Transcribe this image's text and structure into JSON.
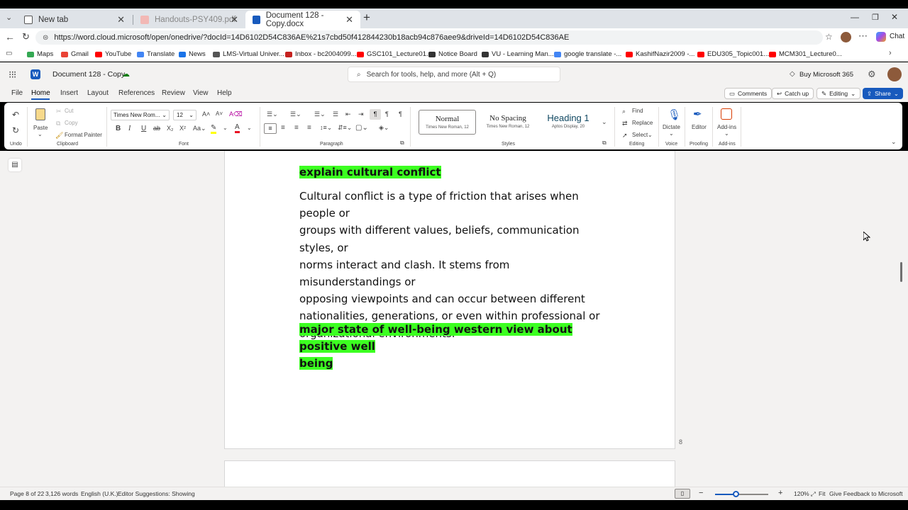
{
  "browser": {
    "tabs": [
      {
        "label": "New tab"
      },
      {
        "label": "Handouts-PSY409.pdf"
      },
      {
        "label": "Document 128 - Copy.docx"
      }
    ],
    "url": "https://word.cloud.microsoft/open/onedrive/?docId=14D6102D54C836AE%21s7cbd50f412844230b18acb94c876aee9&driveId=14D6102D54C836AE",
    "bookmarks": [
      "Maps",
      "Gmail",
      "YouTube",
      "Translate",
      "News",
      "LMS-Virtual Univer...",
      "Inbox - bc2004099...",
      "GSC101_Lecture01...",
      "Notice Board",
      "VU - Learning Man...",
      "google translate -...",
      "KashifNazir2009 -...",
      "EDU305_Topic001...",
      "MCM301_Lecture0..."
    ],
    "chat_label": "Chat"
  },
  "word": {
    "doc_title": "Document 128 - Copy",
    "search_placeholder": "Search for tools, help, and more (Alt + Q)",
    "buy_label": "Buy Microsoft 365",
    "menus": [
      "File",
      "Home",
      "Insert",
      "Layout",
      "References",
      "Review",
      "View",
      "Help"
    ],
    "comments_label": "Comments",
    "catchup_label": "Catch up",
    "editing_label": "Editing",
    "share_label": "Share"
  },
  "ribbon": {
    "undo_label": "Undo",
    "paste_label": "Paste",
    "cut_label": "Cut",
    "copy_label": "Copy",
    "format_painter_label": "Format Painter",
    "clipboard_label": "Clipboard",
    "font_name": "Times New Rom...",
    "font_size": "12",
    "font_label": "Font",
    "paragraph_label": "Paragraph",
    "styles": [
      {
        "name": "Normal",
        "sub": "Times New Roman, 12"
      },
      {
        "name": "No Spacing",
        "sub": "Times New Roman, 12"
      },
      {
        "name": "Heading 1",
        "sub": "Aptos Display, 20"
      }
    ],
    "styles_label": "Styles",
    "find_label": "Find",
    "replace_label": "Replace",
    "select_label": "Select",
    "editing_group_label": "Editing",
    "dictate_label": "Dictate",
    "voice_label": "Voice",
    "editor_label": "Editor",
    "proofing_label": "Proofing",
    "addins_label": "Add-ins",
    "addins_group_label": "Add-ins"
  },
  "document": {
    "heading1": "explain cultural conflict",
    "para_lines": [
      "Cultural conflict is a type of friction that arises when people or",
      "groups with different values, beliefs, communication styles, or",
      "norms interact and clash. It stems from misunderstandings or",
      "opposing viewpoints and can occur between different",
      "nationalities, generations, or even within professional or",
      "organizational environments."
    ],
    "heading2_line1": "major state of well-being western view about positive well",
    "heading2_line2": "being",
    "page_number": "8"
  },
  "status": {
    "page": "Page 8 of 22",
    "words": "3,126 words",
    "language": "English (U.K.)",
    "editor": "Editor Suggestions: Showing",
    "zoom": "120%",
    "fit": "Fit",
    "feedback": "Give Feedback to Microsoft",
    "zoom_level": 0.4
  },
  "colors": {
    "highlight": "#3cff21",
    "accent": "#185abd"
  }
}
